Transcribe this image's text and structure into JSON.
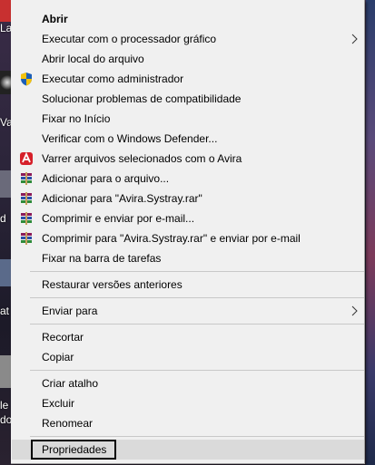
{
  "menu": {
    "items": [
      {
        "label": "Abrir"
      },
      {
        "label": "Executar com o processador gráfico"
      },
      {
        "label": "Abrir local do arquivo"
      },
      {
        "label": "Executar como administrador"
      },
      {
        "label": "Solucionar problemas de compatibilidade"
      },
      {
        "label": "Fixar no Início"
      },
      {
        "label": "Verificar com o Windows Defender..."
      },
      {
        "label": "Varrer arquivos selecionados com o Avira"
      },
      {
        "label": "Adicionar para o arquivo..."
      },
      {
        "label": "Adicionar para \"Avira.Systray.rar\""
      },
      {
        "label": "Comprimir e enviar por e-mail..."
      },
      {
        "label": "Comprimir para \"Avira.Systray.rar\" e enviar por e-mail"
      },
      {
        "label": "Fixar na barra de tarefas"
      },
      {
        "label": "Restaurar versões anteriores"
      },
      {
        "label": "Enviar para"
      },
      {
        "label": "Recortar"
      },
      {
        "label": "Copiar"
      },
      {
        "label": "Criar atalho"
      },
      {
        "label": "Excluir"
      },
      {
        "label": "Renomear"
      },
      {
        "label": "Propriedades"
      }
    ]
  },
  "desktop": {
    "fragments": [
      "La",
      "Var",
      "d",
      "at",
      "le",
      "do"
    ]
  },
  "colors": {
    "menu_bg": "#f0f0f0",
    "separator": "#c8c8c8",
    "highlight": "#dadada",
    "avira_red": "#d6202a",
    "shield_blue": "#1c5fb8",
    "shield_yellow": "#f4c20d"
  },
  "icons": {
    "submenu_arrow": "chevron-right-icon",
    "admin": "uac-shield-icon",
    "avira": "avira-umbrella-icon",
    "winrar": "winrar-books-icon"
  }
}
